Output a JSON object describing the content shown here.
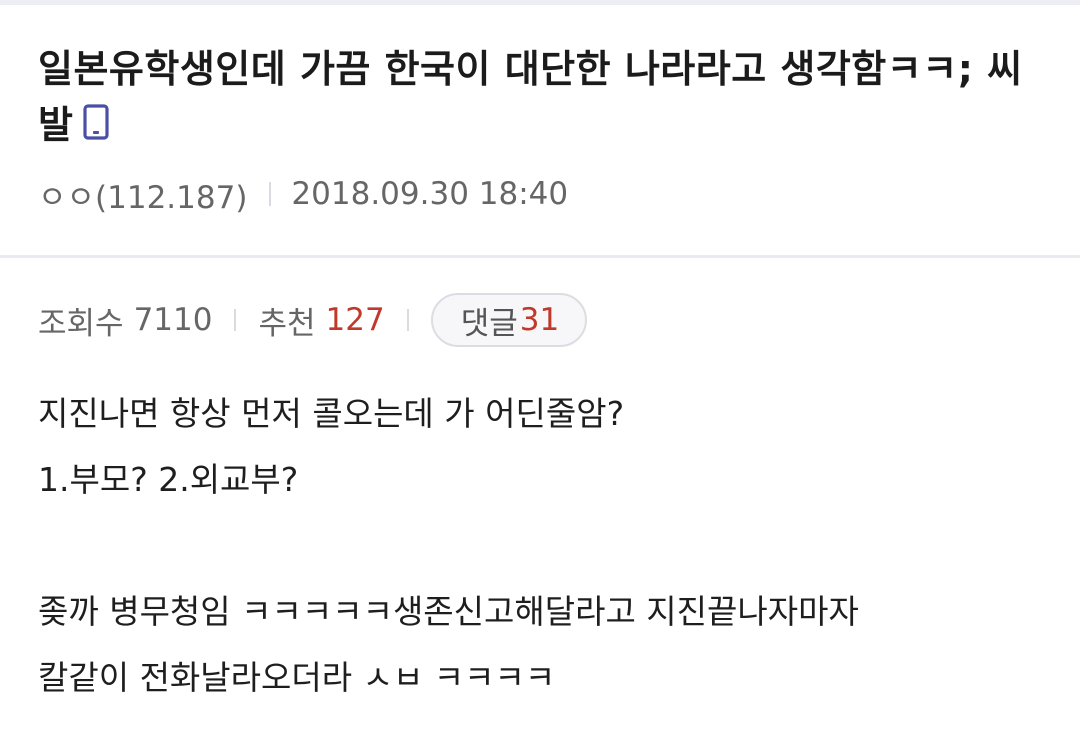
{
  "post": {
    "title": "일본유학생인데 가끔 한국이 대단한 나라라고 생각함ㅋㅋ; 씨발",
    "author": "ㅇㅇ(112.187)",
    "datetime": "2018.09.30 18:40",
    "title_icon": "mobile-phone-icon"
  },
  "stats": {
    "views_label": "조회수",
    "views": "7110",
    "recommend_label": "추천",
    "recommend": "127",
    "comments_label": "댓글",
    "comments": "31",
    "highlight_color": "#c0392b"
  },
  "body": {
    "lines": [
      "지진나면 항상 먼저 콜오는데 가 어딘줄암?",
      "1.부모? 2.외교부?",
      "",
      "좆까 병무청임 ㅋㅋㅋㅋㅋ생존신고해달라고 지진끝나자마자",
      "칼같이 전화날라오더라 ㅅㅂ ㅋㅋㅋㅋ"
    ]
  }
}
